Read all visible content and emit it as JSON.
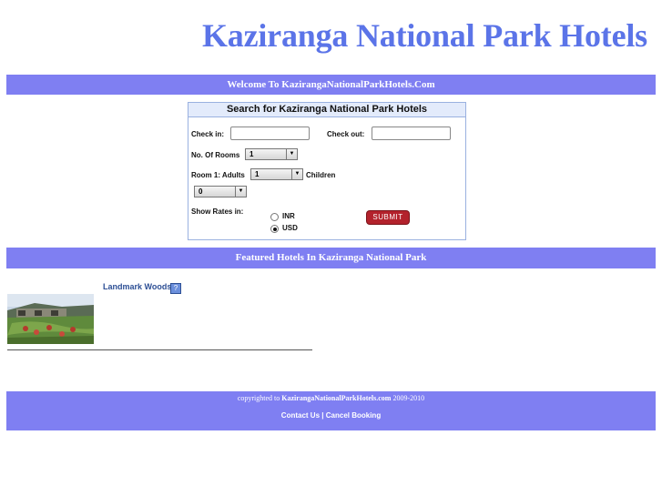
{
  "header": {
    "title": "Kaziranga National Park Hotels"
  },
  "welcome_bar": {
    "text": "Welcome To KazirangaNationalParkHotels.Com"
  },
  "search": {
    "heading": "Search for Kaziranga National Park Hotels",
    "checkin_label": "Check in:",
    "checkin_value": "",
    "checkout_label": "Check out:",
    "checkout_value": "",
    "rooms_label": "No. Of Rooms",
    "rooms_value": "1",
    "room1_adults_label": "Room 1: Adults",
    "adults_value": "1",
    "children_label": "Children",
    "children_value": "0",
    "rates_label": "Show Rates in:",
    "currency_options": [
      {
        "label": "INR",
        "selected": false
      },
      {
        "label": "USD",
        "selected": true
      }
    ],
    "submit_label": "SUBMIT"
  },
  "featured_bar": {
    "text": "Featured Hotels In Kaziranga National Park"
  },
  "hotels": [
    {
      "name": "Landmark Woods"
    }
  ],
  "footer": {
    "copyright_prefix": "copyrighted to",
    "site_name": "KazirangaNationalParkHotels.com",
    "years": "2009-2010",
    "contact_label": "Contact Us",
    "separator": "|",
    "cancel_label": "Cancel Booking"
  },
  "colors": {
    "accent": "#7f7ff2",
    "title": "#5b74e8",
    "submit": "#b3222c"
  }
}
